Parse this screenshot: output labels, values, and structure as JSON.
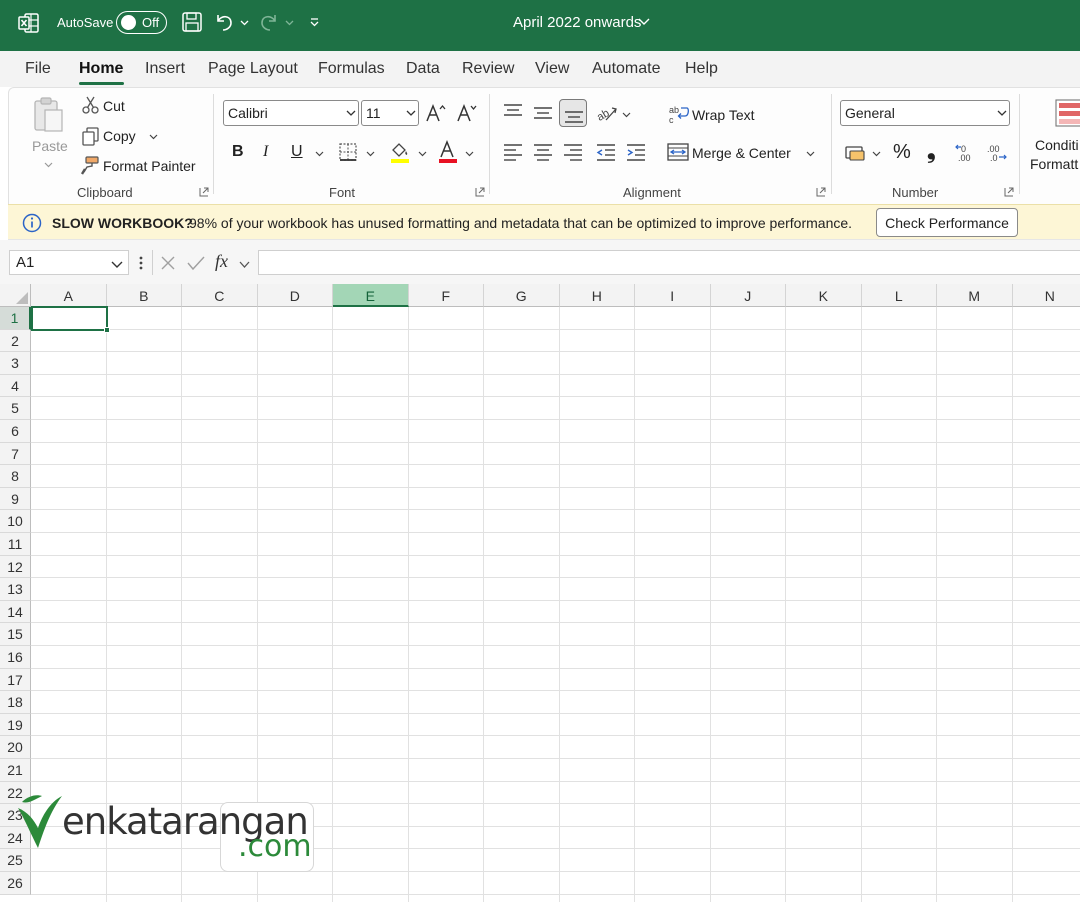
{
  "titlebar": {
    "autosave_label": "AutoSave",
    "autosave_state": "Off",
    "document_title": "April 2022 onwards"
  },
  "menu": {
    "tabs": [
      "File",
      "Home",
      "Insert",
      "Page Layout",
      "Formulas",
      "Data",
      "Review",
      "View",
      "Automate",
      "Help"
    ],
    "active": "Home"
  },
  "ribbon": {
    "clipboard": {
      "paste": "Paste",
      "cut": "Cut",
      "copy": "Copy",
      "format_painter": "Format Painter",
      "group": "Clipboard"
    },
    "font": {
      "name": "Calibri",
      "size": "11",
      "group": "Font",
      "bold": "B",
      "italic": "I",
      "underline": "U",
      "highlight_color": "#ffff00",
      "font_color": "#e81123"
    },
    "alignment": {
      "wrap_text": "Wrap Text",
      "merge_center": "Merge & Center",
      "group": "Alignment"
    },
    "number": {
      "format": "General",
      "group": "Number",
      "percent": "%",
      "comma": "❟"
    },
    "styles": {
      "conditional_1": "Conditi",
      "conditional_2": "Formatt"
    }
  },
  "infobar": {
    "title": "SLOW WORKBOOK?",
    "message": "98% of your workbook has unused formatting and metadata that can be optimized to improve performance.",
    "button": "Check Performance"
  },
  "formula_bar": {
    "name_box": "A1",
    "fx": "fx",
    "value": ""
  },
  "grid": {
    "columns": [
      "A",
      "B",
      "C",
      "D",
      "E",
      "F",
      "G",
      "H",
      "I",
      "J",
      "K",
      "L",
      "M",
      "N"
    ],
    "selected_column": "E",
    "rows": [
      "1",
      "2",
      "3",
      "4",
      "5",
      "6",
      "7",
      "8",
      "9",
      "10",
      "11",
      "12",
      "13",
      "14",
      "15",
      "16",
      "17",
      "18",
      "19",
      "20",
      "21",
      "22",
      "23",
      "24",
      "25",
      "26"
    ],
    "selected_row": "1",
    "active_cell": "A1"
  },
  "watermark": {
    "part1": "enkatarangan",
    "part2": ".com"
  },
  "colors": {
    "brand_green": "#1e7145",
    "infobar_bg": "#fdf6d6"
  }
}
